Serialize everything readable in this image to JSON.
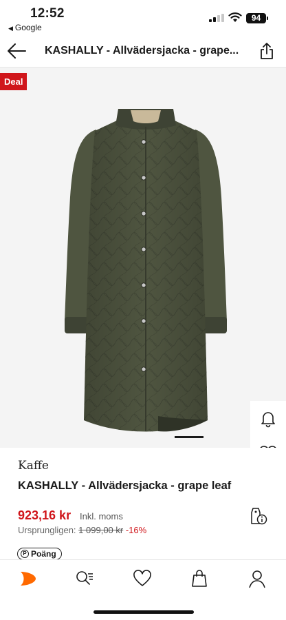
{
  "status_bar": {
    "time": "12:52",
    "back_app": "Google",
    "battery": "94"
  },
  "nav": {
    "title": "KASHALLY - Allvädersjacka - grape..."
  },
  "badge": {
    "label": "Deal",
    "color": "#d0161b"
  },
  "product": {
    "brand": "Kaffe",
    "name": "KASHALLY - Allvädersjacka - grape leaf",
    "price": "923,16 kr",
    "price_note": "Inkl. moms",
    "original_label": "Ursprungligen:",
    "original_price": "1 099,00 kr",
    "discount": "-16%",
    "points_label": "Poäng",
    "accent_color": "#d0161b",
    "image_color": "#4f5540"
  },
  "gallery": {
    "current_index": 1,
    "total_images": 1
  },
  "icons": {
    "back": "arrow-left-icon",
    "share": "share-icon",
    "bell": "bell-icon",
    "heart": "heart-icon",
    "bag": "shopping-bag-icon",
    "outfit": "outfit-icon",
    "pricetag": "pricetag-info-icon"
  },
  "tabs": [
    {
      "name": "home",
      "icon": "zalando-logo-icon"
    },
    {
      "name": "search",
      "icon": "search-icon"
    },
    {
      "name": "wishlist",
      "icon": "heart-icon"
    },
    {
      "name": "bag",
      "icon": "bag-icon"
    },
    {
      "name": "profile",
      "icon": "user-icon"
    }
  ]
}
